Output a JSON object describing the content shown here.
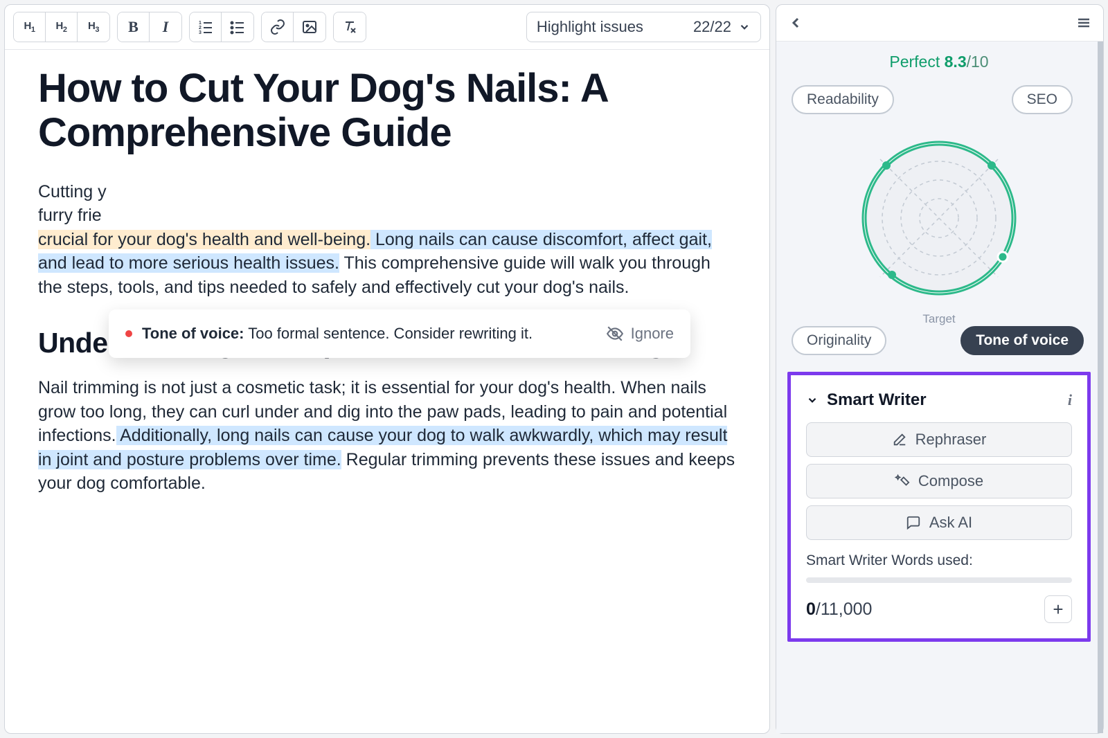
{
  "toolbar": {
    "h1": "H",
    "h1sub": "1",
    "h2": "H",
    "h2sub": "2",
    "h3": "H",
    "h3sub": "3",
    "issues_label": "Highlight issues",
    "issues_count": "22/22"
  },
  "tooltip": {
    "label": "Tone of voice:",
    "text": "Too formal sentence. Consider rewriting it.",
    "ignore": "Ignore"
  },
  "doc": {
    "title": "How to Cut Your Dog's Nails: A Comprehensive Guide",
    "p1a": "Cutting y",
    "p1b": "furry frie",
    "p1_orange": "crucial for your dog's health and well-being.",
    "p1_blue": " Long nails can cause discomfort, affect gait, and lead to more serious health issues.",
    "p1c": " This comprehensive guide will walk you through the steps, tools, and tips needed to safely and effectively cut your dog's nails.",
    "h2": "Understanding the Importance of Nail Trimming",
    "p2a": "Nail trimming is not just a cosmetic task; it is essential for your dog's health. When nails grow too long, they can curl under and dig into the paw pads, leading to pain and potential infections.",
    "p2_blue": " Additionally, long nails can cause your dog to walk awkwardly, which may result in joint and posture problems over time.",
    "p2b": " Regular trimming prevents these issues and keeps your dog comfortable."
  },
  "side": {
    "score_word": "Perfect",
    "score_val": "8.3",
    "score_of": "/10",
    "pills": {
      "readability": "Readability",
      "seo": "SEO",
      "originality": "Originality",
      "tone": "Tone of voice"
    },
    "target": "Target",
    "smart_writer": "Smart Writer",
    "rephraser": "Rephraser",
    "compose": "Compose",
    "ask_ai": "Ask AI",
    "words_used_label": "Smart Writer Words used:",
    "words_used_cur": "0",
    "words_used_max": "/11,000"
  }
}
